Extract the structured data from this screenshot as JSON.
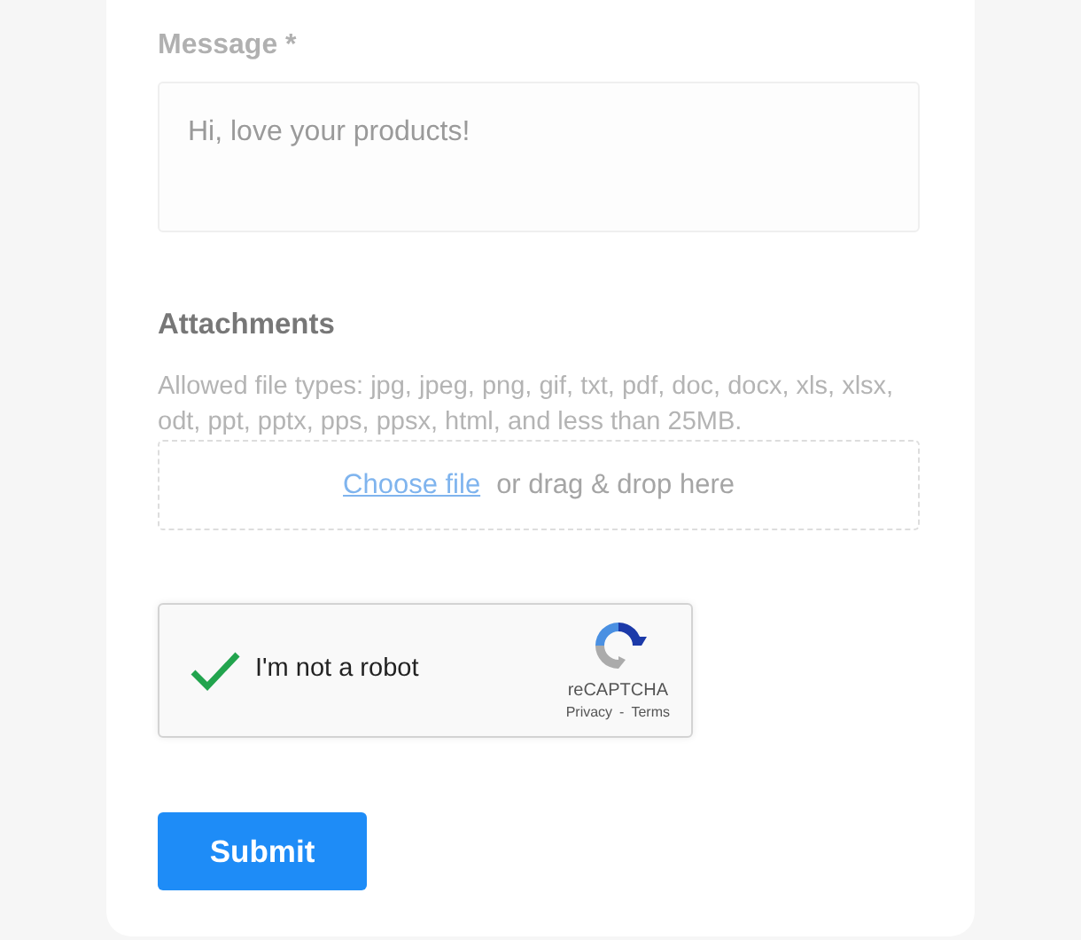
{
  "message": {
    "label": "Message *",
    "placeholder": "Hi, love your products!"
  },
  "attachments": {
    "heading": "Attachments",
    "help": "Allowed file types: jpg, jpeg, png, gif, txt, pdf, doc, docx, xls, xlsx, odt, ppt, pptx, pps, ppsx, html, and less than 25MB.",
    "link": "Choose file",
    "rest": "or drag & drop here"
  },
  "captcha": {
    "label": "I'm not a robot",
    "checked": true,
    "brand": "reCAPTCHA",
    "privacy": "Privacy",
    "separator": "-",
    "terms": "Terms"
  },
  "submit": "Submit"
}
